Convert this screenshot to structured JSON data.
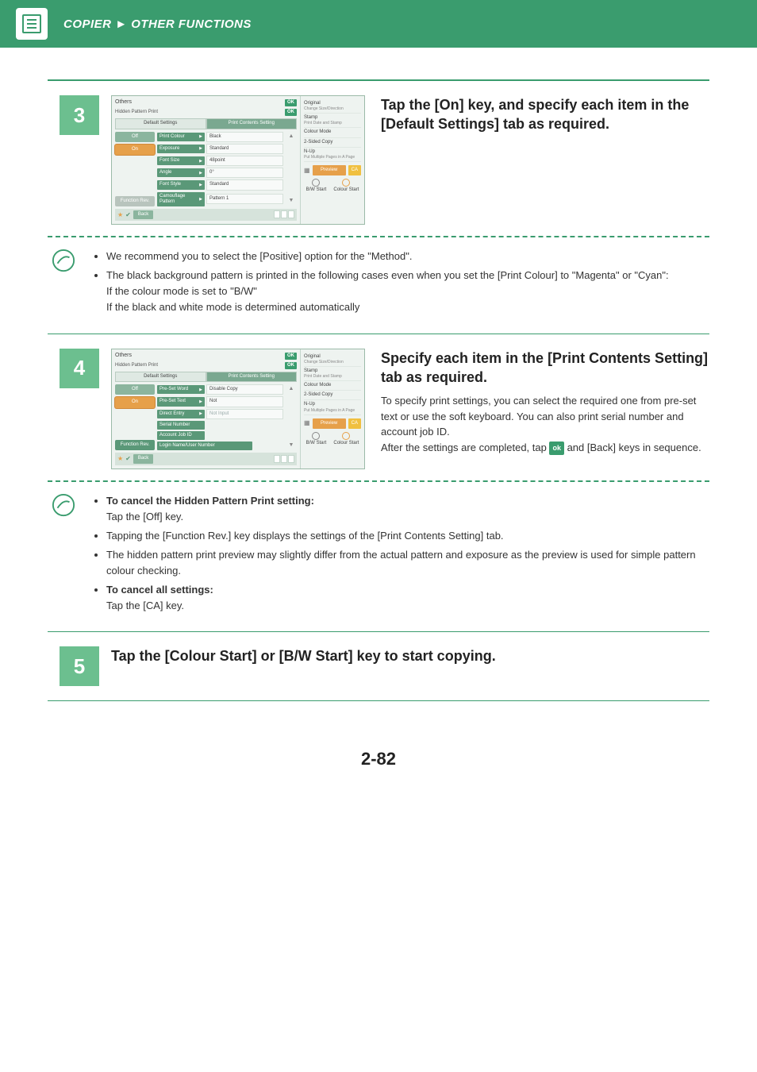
{
  "breadcrumb": {
    "section": "COPIER",
    "sep": "►",
    "page": "OTHER FUNCTIONS"
  },
  "page_number": "2-82",
  "step3": {
    "num": "3",
    "title": "Tap the [On] key, and specify each item in the [Default Settings] tab as required."
  },
  "step4": {
    "num": "4",
    "title": "Specify each item in the [Print Contents Setting] tab as required.",
    "desc1": "To specify print settings, you can select the required one from pre-set text or use the soft keyboard. You can also print serial number and account job ID.",
    "desc2a": "After the settings are completed, tap ",
    "ok_label": "ok",
    "desc2b": " and [Back] keys in sequence."
  },
  "step5": {
    "num": "5",
    "title": "Tap the [Colour Start] or [B/W Start] key to start copying."
  },
  "note1": {
    "l1": "We recommend you to select the [Positive] option for the \"Method\".",
    "l2": "The black background pattern is printed in the following cases even when you set the [Print Colour] to \"Magenta\" or \"Cyan\":",
    "l3": "If the colour mode is set to \"B/W\"",
    "l4": "If the black and white mode is determined automatically"
  },
  "note2": {
    "b1_bold": "To cancel the Hidden Pattern Print setting:",
    "b1_text": "Tap the [Off] key.",
    "b2": "Tapping the [Function Rev.] key displays the settings of the [Print Contents Setting] tab.",
    "b3": "The hidden pattern print preview may slightly differ from the actual pattern and exposure as the preview is used for simple pattern colour checking.",
    "b4_bold": "To cancel all settings:",
    "b4_text": "Tap the [CA] key."
  },
  "device_common": {
    "others": "Others",
    "hidden": "Hidden Pattern Print",
    "ok": "OK",
    "tab_default": "Default Settings",
    "tab_contents": "Print Contents Setting",
    "off": "Off",
    "on": "On",
    "function_rev": "Function Rev.",
    "back": "Back",
    "right": {
      "original": "Original",
      "original_sub": "Change Size/Direction",
      "stamp": "Stamp",
      "stamp_sub": "Print Date and Stamp",
      "colour_mode": "Colour Mode",
      "two_sided": "2-Sided Copy",
      "nup": "N-Up",
      "nup_sub": "Put Multiple Pages in A Page",
      "preview": "Preview",
      "ca": "CA",
      "bw_start": "B/W Start",
      "colour_start": "Colour Start"
    }
  },
  "device3_settings": [
    {
      "k": "Print Colour",
      "v": "Black"
    },
    {
      "k": "Exposure",
      "v": "Standard"
    },
    {
      "k": "Font Size",
      "v": "48point"
    },
    {
      "k": "Angle",
      "v": "0°"
    },
    {
      "k": "Font Style",
      "v": "Standard"
    },
    {
      "k": "Camouflage Pattern",
      "v": "Pattern 1"
    }
  ],
  "device4_settings": [
    {
      "k": "Pre-Set Word",
      "v": "Disable Copy",
      "arrow": true
    },
    {
      "k": "Pre-Set Text",
      "v": "Not",
      "arrow": true
    },
    {
      "k": "Direct Entry",
      "v": "Not Input",
      "arrow": true,
      "muted": true
    },
    {
      "k": "Serial Number",
      "v": "",
      "arrow": false
    },
    {
      "k": "Account Job ID",
      "v": "",
      "arrow": false
    },
    {
      "k": "Login Name/User Number",
      "v": "",
      "arrow": false,
      "wide": true
    }
  ]
}
